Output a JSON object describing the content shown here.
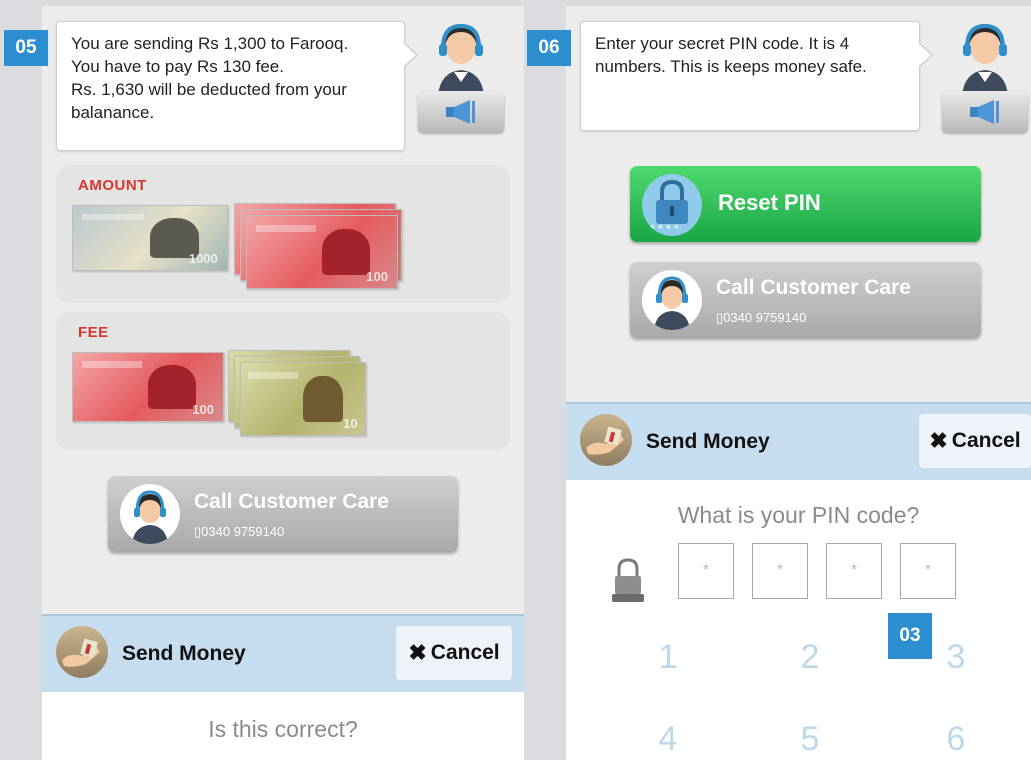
{
  "colors": {
    "badge": "#2e8fd0",
    "amount_label": "#d8362f",
    "reset_green": "#28b44f",
    "bar_blue": "#c6ddf0"
  },
  "left_screen": {
    "step": "05",
    "message_lines": [
      "You are sending Rs 1,300 to Farooq.",
      "You have to pay Rs 130 fee.",
      "Rs. 1,630 will be deducted from your",
      "balanance."
    ],
    "speaker_icon": "megaphone-icon",
    "amount_label": "AMOUNT",
    "amount_notes": [
      "1000",
      "100",
      "100",
      "100"
    ],
    "fee_label": "FEE",
    "fee_notes": [
      "100",
      "10",
      "10",
      "10"
    ],
    "call_care_label": "Call Customer Care",
    "call_care_phone": "0340 9759140",
    "action_bar": {
      "title": "Send Money",
      "cancel": "Cancel"
    },
    "question": "Is this correct?"
  },
  "right_screen": {
    "step": "06",
    "message_lines": [
      "Enter your secret PIN code. It is 4",
      "numbers. This is keeps money safe."
    ],
    "reset_pin_label": "Reset PIN",
    "call_care_label": "Call Customer Care",
    "call_care_phone": "0340 9759140",
    "action_bar": {
      "title": "Send Money",
      "cancel": "Cancel"
    },
    "question": "What is your PIN code?",
    "pin_boxes": [
      "*",
      "*",
      "*",
      "*"
    ],
    "keypad": [
      "1",
      "2",
      "3",
      "4",
      "5",
      "6"
    ],
    "overlay_step": "03"
  }
}
